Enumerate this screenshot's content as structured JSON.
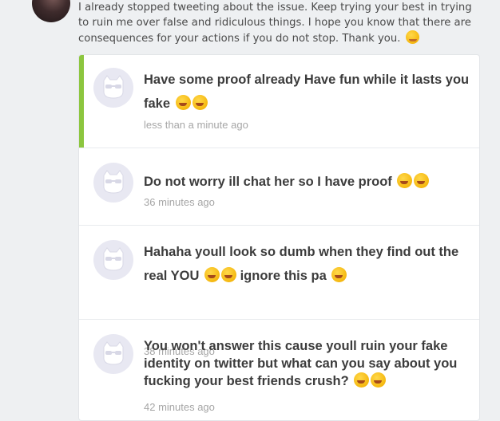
{
  "message": {
    "text": "I already stopped tweeting about the issue. Keep trying your best in trying to ruin me over false and ridiculous things. I hope you know that there are consequences for your actions if you do not stop. Thank you.",
    "emoji": "smiling-face-icon"
  },
  "replies": [
    {
      "text": "Have some proof already Have fun while it lasts you fake",
      "time": "less than a minute ago",
      "emoji_count": 2,
      "highlighted": true
    },
    {
      "text": "Do not worry ill chat her so I have proof",
      "time": "36 minutes ago",
      "emoji_count": 2
    },
    {
      "text_a": "Hahaha youll look so dumb when they find out the real YOU",
      "text_b": "ignore this pa",
      "time": "38 minutes ago",
      "emoji_count": 3
    },
    {
      "text": "You won't answer this cause youll ruin your fake identity on twitter but what can you say about you fucking your best friends crush?",
      "time": "42 minutes ago",
      "emoji_count": 2
    }
  ],
  "colors": {
    "accent": "#8cc63f",
    "background": "#eef0f2"
  }
}
